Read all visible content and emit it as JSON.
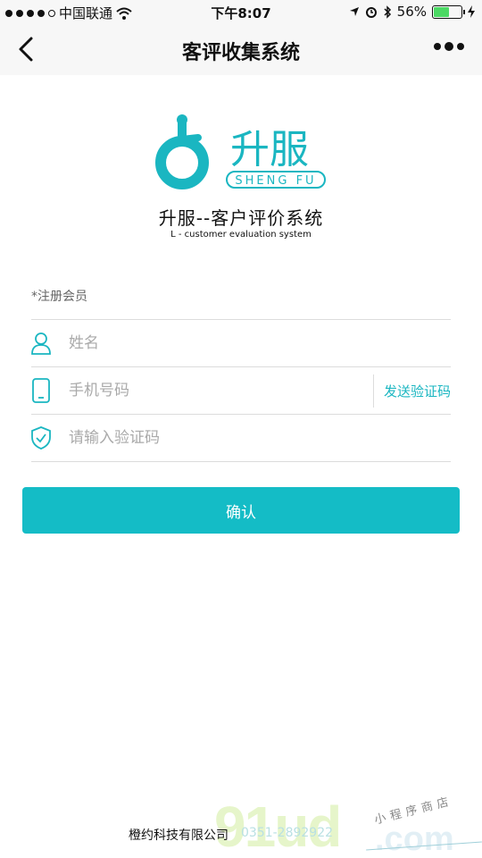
{
  "status_bar": {
    "carrier": "中国联通",
    "time": "下午8:07",
    "battery": "56%",
    "battery_level": 0.56
  },
  "nav": {
    "title": "客评收集系统",
    "back_icon": "chevron-left-icon",
    "more_icon": "more-dots-icon"
  },
  "brand": {
    "logo_cn": "升服",
    "logo_en": "SHENG FU",
    "title": "升服--客户评价系统",
    "subtitle": "L - customer evaluation system",
    "accent": "#1ab6c1"
  },
  "form": {
    "hint": "*注册会员",
    "name_placeholder": "姓名",
    "phone_placeholder": "手机号码",
    "send_code_label": "发送验证码",
    "code_placeholder": "请输入验证码",
    "confirm_label": "确认"
  },
  "footer": {
    "company": "橙约科技有限公司",
    "phone": "0351-2892922"
  },
  "watermark": {
    "main": "91ud",
    "suffix": ".com",
    "note": "小程序商店"
  }
}
